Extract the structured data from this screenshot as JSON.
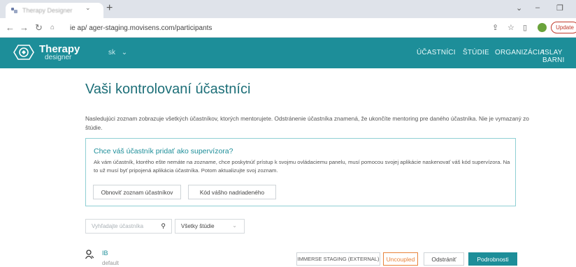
{
  "browser": {
    "tab_title": "Therapy Designer",
    "url_text": "ie ap/ ager-staging.movisens.com/participants",
    "update_label": "Update"
  },
  "app": {
    "logo_word": "Therapy",
    "logo_sub": "designer",
    "user_label": "sk",
    "nav": [
      "ÚČASTNÍCI",
      "ŠTÚDIE",
      "ORGANIZÁCIA",
      "ISLAY BARNI"
    ]
  },
  "page": {
    "title": "Vaši kontrolovaní účastníci",
    "intro": "Nasledujúci zoznam zobrazuje všetkých účastníkov, ktorých mentorujete. Odstránenie účastníka znamená, že ukončíte mentoring pre daného účastníka. Nie je vymazaný zo štúdie."
  },
  "panel": {
    "heading": "Chce váš účastník pridať ako supervízora?",
    "text": "Ak vám účastník, ktorého ešte nemáte na zozname, chce poskytnúť prístup k svojmu ovládaciemu panelu, musí pomocou svojej aplikácie naskenovať váš kód supervízora. Na to už musí byť pripojená aplikácia účastníka. Potom aktualizujte svoj zoznam.",
    "refresh_label": "Obnoviť zoznam účastníkov",
    "code_label": "Kód vášho nadriadeného"
  },
  "filters": {
    "search_placeholder": "Vyhľadajte účastníka",
    "study_select": "Všetky štúdie"
  },
  "participant": {
    "name": "IB",
    "group": "default",
    "study_tag": "IMMERSE STAGING (EXTERNAL)",
    "status": "Uncoupled",
    "remove_label": "Odstrániť",
    "details_label": "Podrobnosti"
  },
  "colors": {
    "brand_teal": "#1d8e99",
    "status_orange": "#e8823a"
  }
}
